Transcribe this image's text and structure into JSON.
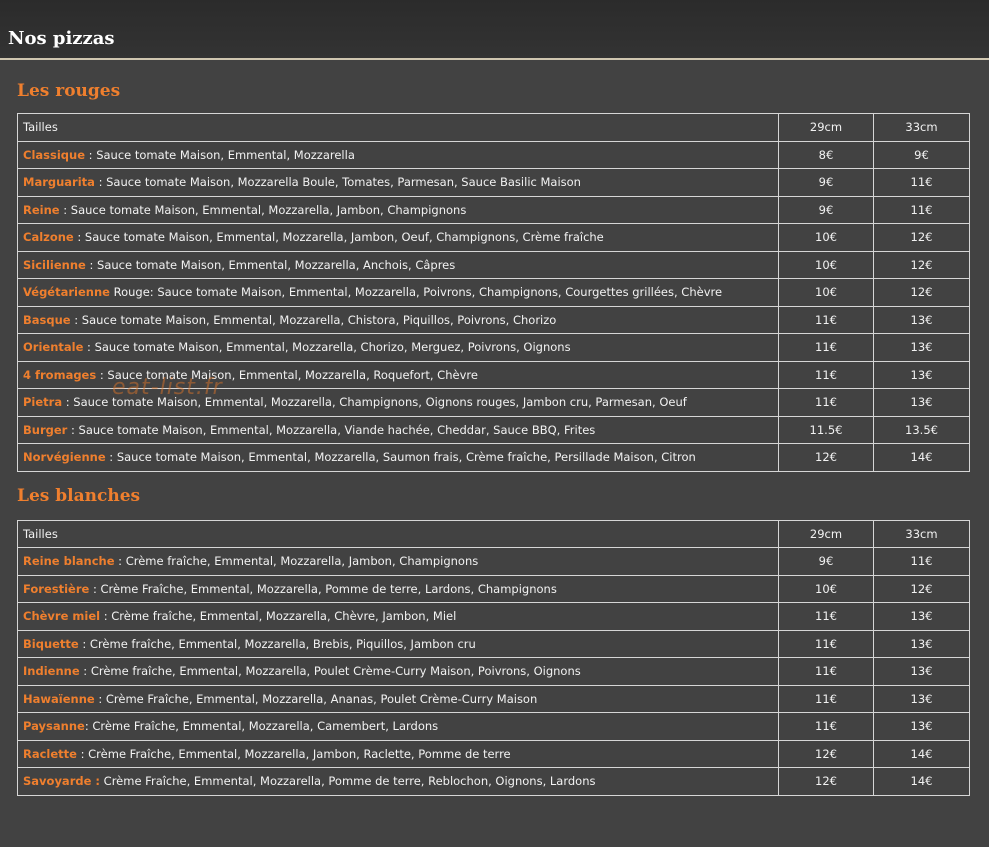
{
  "header": {
    "title": "Nos pizzas"
  },
  "watermark": "eat-list.fr",
  "sections": [
    {
      "title": "Les rouges",
      "table": {
        "header": {
          "label": "Tailles",
          "size1": "29cm",
          "size2": "33cm"
        },
        "rows": [
          {
            "name": "Classique",
            "sep": " : ",
            "desc": "Sauce tomate Maison, Emmental, Mozzarella",
            "p1": "8€",
            "p2": "9€"
          },
          {
            "name": "Marguarita",
            "sep": " : ",
            "desc": "Sauce tomate Maison, Mozzarella Boule, Tomates, Parmesan, Sauce Basilic Maison",
            "p1": "9€",
            "p2": "11€"
          },
          {
            "name": "Reine",
            "sep": " : ",
            "desc": "Sauce tomate Maison, Emmental, Mozzarella, Jambon, Champignons",
            "p1": "9€",
            "p2": "11€"
          },
          {
            "name": "Calzone",
            "sep": " : ",
            "desc": "Sauce tomate Maison, Emmental, Mozzarella, Jambon, Oeuf, Champignons, Crème fraîche",
            "p1": "10€",
            "p2": "12€"
          },
          {
            "name": "Sicilienne",
            "sep": " : ",
            "desc": "Sauce tomate Maison, Emmental, Mozzarella, Anchois, Câpres",
            "p1": "10€",
            "p2": "12€"
          },
          {
            "name": "Végétarienne",
            "sep": " ",
            "desc": "Rouge: Sauce tomate Maison, Emmental, Mozzarella, Poivrons, Champignons, Courgettes grillées, Chèvre",
            "p1": "10€",
            "p2": "12€"
          },
          {
            "name": "Basque",
            "sep": " : ",
            "desc": "Sauce tomate Maison, Emmental, Mozzarella, Chistora, Piquillos, Poivrons, Chorizo",
            "p1": "11€",
            "p2": "13€"
          },
          {
            "name": "Orientale",
            "sep": " : ",
            "desc": "Sauce tomate Maison, Emmental, Mozzarella, Chorizo, Merguez, Poivrons, Oignons",
            "p1": "11€",
            "p2": "13€"
          },
          {
            "name": "4 fromages",
            "sep": " : ",
            "desc": "Sauce tomate Maison, Emmental, Mozzarella, Roquefort, Chèvre",
            "p1": "11€",
            "p2": "13€"
          },
          {
            "name": "Pietra",
            "sep": " : ",
            "desc": "Sauce tomate Maison, Emmental, Mozzarella, Champignons, Oignons rouges, Jambon cru, Parmesan, Oeuf",
            "p1": "11€",
            "p2": "13€"
          },
          {
            "name": "Burger",
            "sep": " : ",
            "desc": "Sauce tomate Maison, Emmental, Mozzarella, Viande hachée, Cheddar, Sauce BBQ, Frites",
            "p1": "11.5€",
            "p2": "13.5€"
          },
          {
            "name": "Norvégienne",
            "sep": " : ",
            "desc": "Sauce tomate Maison, Emmental, Mozzarella, Saumon frais, Crème fraîche, Persillade Maison, Citron",
            "p1": "12€",
            "p2": "14€"
          }
        ]
      }
    },
    {
      "title": "Les blanches",
      "table": {
        "header": {
          "label": "Tailles",
          "size1": "29cm",
          "size2": "33cm"
        },
        "rows": [
          {
            "name": "Reine blanche",
            "sep": " : ",
            "desc": "Crème fraîche, Emmental, Mozzarella, Jambon, Champignons",
            "p1": "9€",
            "p2": "11€"
          },
          {
            "name": "Forestière",
            "sep": " : ",
            "desc": "Crème Fraîche, Emmental, Mozzarella, Pomme de terre, Lardons, Champignons",
            "p1": "10€",
            "p2": "12€"
          },
          {
            "name": "Chèvre miel",
            "sep": " : ",
            "desc": "Crème fraîche, Emmental, Mozzarella, Chèvre, Jambon, Miel",
            "p1": "11€",
            "p2": "13€"
          },
          {
            "name": "Biquette",
            "sep": " : ",
            "desc": "Crème fraîche, Emmental, Mozzarella, Brebis, Piquillos, Jambon cru",
            "p1": "11€",
            "p2": "13€"
          },
          {
            "name": "Indienne",
            "sep": " : ",
            "desc": "Crème fraîche, Emmental, Mozzarella, Poulet Crème-Curry Maison, Poivrons, Oignons",
            "p1": "11€",
            "p2": "13€"
          },
          {
            "name": "Hawaïenne",
            "sep": " : ",
            "desc": "Crème Fraîche, Emmental, Mozzarella, Ananas, Poulet Crème-Curry Maison",
            "p1": "11€",
            "p2": "13€"
          },
          {
            "name": "Paysanne",
            "sep": ": ",
            "desc": "Crème Fraîche, Emmental, Mozzarella, Camembert, Lardons",
            "p1": "11€",
            "p2": "13€"
          },
          {
            "name": "Raclette",
            "sep": " : ",
            "desc": "Crème Fraîche, Emmental, Mozzarella, Jambon, Raclette, Pomme de terre",
            "p1": "12€",
            "p2": "14€"
          },
          {
            "name": "Savoyarde :",
            "sep": " ",
            "desc": "Crème Fraîche, Emmental, Mozzarella, Pomme de terre, Reblochon, Oignons, Lardons",
            "p1": "12€",
            "p2": "14€"
          }
        ]
      }
    }
  ],
  "colors": {
    "accent": "#ef7f2e",
    "background": "#424242",
    "header_bg": "#2e2e2e",
    "border": "#d6d6d6"
  }
}
